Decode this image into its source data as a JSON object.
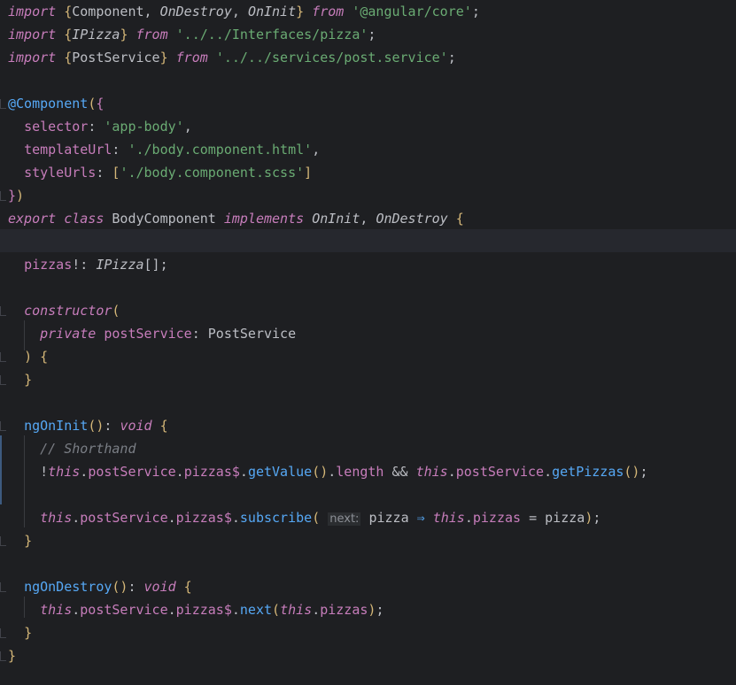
{
  "editor": {
    "lines": [
      {
        "tokens": [
          [
            "kwi",
            "import "
          ],
          [
            "brace",
            "{"
          ],
          [
            "plain",
            "Component, "
          ],
          [
            "iface",
            "OnDestroy"
          ],
          [
            "plain",
            ", "
          ],
          [
            "iface",
            "OnInit"
          ],
          [
            "brace",
            "}"
          ],
          [
            "kwi",
            " from "
          ],
          [
            "str",
            "'@angular/core'"
          ],
          [
            "plain",
            ";"
          ]
        ]
      },
      {
        "tokens": [
          [
            "kwi",
            "import "
          ],
          [
            "brace",
            "{"
          ],
          [
            "iface",
            "IPizza"
          ],
          [
            "brace",
            "}"
          ],
          [
            "kwi",
            " from "
          ],
          [
            "str",
            "'../../Interfaces/pizza'"
          ],
          [
            "plain",
            ";"
          ]
        ]
      },
      {
        "tokens": [
          [
            "kwi",
            "import "
          ],
          [
            "brace",
            "{"
          ],
          [
            "plain",
            "PostService"
          ],
          [
            "brace",
            "}"
          ],
          [
            "kwi",
            " from "
          ],
          [
            "str",
            "'../../services/post.service'"
          ],
          [
            "plain",
            ";"
          ]
        ]
      },
      {
        "tokens": []
      },
      {
        "tokens": [
          [
            "deco",
            "@Component"
          ],
          [
            "paren",
            "("
          ],
          [
            "brace2",
            "{"
          ]
        ]
      },
      {
        "tokens": [
          [
            "plain",
            "  "
          ],
          [
            "prop",
            "selector"
          ],
          [
            "plain",
            ": "
          ],
          [
            "str",
            "'app-body'"
          ],
          [
            "plain",
            ","
          ]
        ]
      },
      {
        "tokens": [
          [
            "plain",
            "  "
          ],
          [
            "prop",
            "templateUrl"
          ],
          [
            "plain",
            ": "
          ],
          [
            "str",
            "'./body.component.html'"
          ],
          [
            "plain",
            ","
          ]
        ]
      },
      {
        "tokens": [
          [
            "plain",
            "  "
          ],
          [
            "prop",
            "styleUrls"
          ],
          [
            "plain",
            ": "
          ],
          [
            "brace",
            "["
          ],
          [
            "str",
            "'./body.component.scss'"
          ],
          [
            "brace",
            "]"
          ]
        ]
      },
      {
        "tokens": [
          [
            "brace2",
            "}"
          ],
          [
            "paren",
            ")"
          ]
        ]
      },
      {
        "tokens": [
          [
            "kwi",
            "export class "
          ],
          [
            "plain",
            "BodyComponent "
          ],
          [
            "kwi",
            "implements "
          ],
          [
            "iface",
            "OnInit"
          ],
          [
            "plain",
            ", "
          ],
          [
            "iface",
            "OnDestroy"
          ],
          [
            "brace",
            " {"
          ]
        ]
      },
      {
        "tokens": []
      },
      {
        "tokens": [
          [
            "plain",
            "  "
          ],
          [
            "field",
            "pizzas"
          ],
          [
            "plain",
            "!: "
          ],
          [
            "iface",
            "IPizza"
          ],
          [
            "plain",
            "[];"
          ]
        ]
      },
      {
        "tokens": []
      },
      {
        "tokens": [
          [
            "plain",
            "  "
          ],
          [
            "kwi",
            "constructor"
          ],
          [
            "paren",
            "("
          ]
        ]
      },
      {
        "tokens": [
          [
            "plain",
            "    "
          ],
          [
            "kwi",
            "private "
          ],
          [
            "field",
            "postService"
          ],
          [
            "plain",
            ": "
          ],
          [
            "plain",
            "PostService"
          ]
        ]
      },
      {
        "tokens": [
          [
            "plain",
            "  "
          ],
          [
            "paren",
            ")"
          ],
          [
            "brace",
            " {"
          ]
        ]
      },
      {
        "tokens": [
          [
            "plain",
            "  "
          ],
          [
            "brace",
            "}"
          ]
        ]
      },
      {
        "tokens": []
      },
      {
        "tokens": [
          [
            "plain",
            "  "
          ],
          [
            "fn",
            "ngOnInit"
          ],
          [
            "paren",
            "()"
          ],
          [
            "plain",
            ": "
          ],
          [
            "kwi",
            "void"
          ],
          [
            "brace",
            " {"
          ]
        ]
      },
      {
        "tokens": [
          [
            "plain",
            "    "
          ],
          [
            "cmt",
            "// Shorthand"
          ]
        ]
      },
      {
        "tokens": [
          [
            "plain",
            "    "
          ],
          [
            "plain",
            "!"
          ],
          [
            "kwi",
            "this"
          ],
          [
            "plain",
            "."
          ],
          [
            "field",
            "postService"
          ],
          [
            "plain",
            "."
          ],
          [
            "field",
            "pizzas$"
          ],
          [
            "plain",
            "."
          ],
          [
            "fn",
            "getValue"
          ],
          [
            "paren",
            "()"
          ],
          [
            "plain",
            "."
          ],
          [
            "field",
            "length"
          ],
          [
            "plain",
            " && "
          ],
          [
            "kwi",
            "this"
          ],
          [
            "plain",
            "."
          ],
          [
            "field",
            "postService"
          ],
          [
            "plain",
            "."
          ],
          [
            "fn",
            "getPizzas"
          ],
          [
            "paren",
            "()"
          ],
          [
            "plain",
            ";"
          ]
        ]
      },
      {
        "tokens": []
      },
      {
        "tokens": [
          [
            "plain",
            "    "
          ],
          [
            "kwi",
            "this"
          ],
          [
            "plain",
            "."
          ],
          [
            "field",
            "postService"
          ],
          [
            "plain",
            "."
          ],
          [
            "field",
            "pizzas$"
          ],
          [
            "plain",
            "."
          ],
          [
            "fn",
            "subscribe"
          ],
          [
            "paren",
            "("
          ],
          [
            "plain",
            " "
          ],
          [
            "hint",
            "next:"
          ],
          [
            "plain",
            " pizza "
          ],
          [
            "fn",
            "⇒"
          ],
          [
            "plain",
            " "
          ],
          [
            "kwi",
            "this"
          ],
          [
            "plain",
            "."
          ],
          [
            "field",
            "pizzas"
          ],
          [
            "plain",
            " = pizza"
          ],
          [
            "paren",
            ")"
          ],
          [
            "plain",
            ";"
          ]
        ]
      },
      {
        "tokens": [
          [
            "plain",
            "  "
          ],
          [
            "brace",
            "}"
          ]
        ]
      },
      {
        "tokens": []
      },
      {
        "tokens": [
          [
            "plain",
            "  "
          ],
          [
            "fn",
            "ngOnDestroy"
          ],
          [
            "paren",
            "()"
          ],
          [
            "plain",
            ": "
          ],
          [
            "kwi",
            "void"
          ],
          [
            "brace",
            " {"
          ]
        ]
      },
      {
        "tokens": [
          [
            "plain",
            "    "
          ],
          [
            "kwi",
            "this"
          ],
          [
            "plain",
            "."
          ],
          [
            "field",
            "postService"
          ],
          [
            "plain",
            "."
          ],
          [
            "field",
            "pizzas$"
          ],
          [
            "plain",
            "."
          ],
          [
            "fn",
            "next"
          ],
          [
            "paren",
            "("
          ],
          [
            "kwi",
            "this"
          ],
          [
            "plain",
            "."
          ],
          [
            "field",
            "pizzas"
          ],
          [
            "paren",
            ")"
          ],
          [
            "plain",
            ";"
          ]
        ]
      },
      {
        "tokens": [
          [
            "plain",
            "  "
          ],
          [
            "brace",
            "}"
          ]
        ]
      },
      {
        "tokens": [
          [
            "brace",
            "}"
          ]
        ]
      }
    ]
  }
}
